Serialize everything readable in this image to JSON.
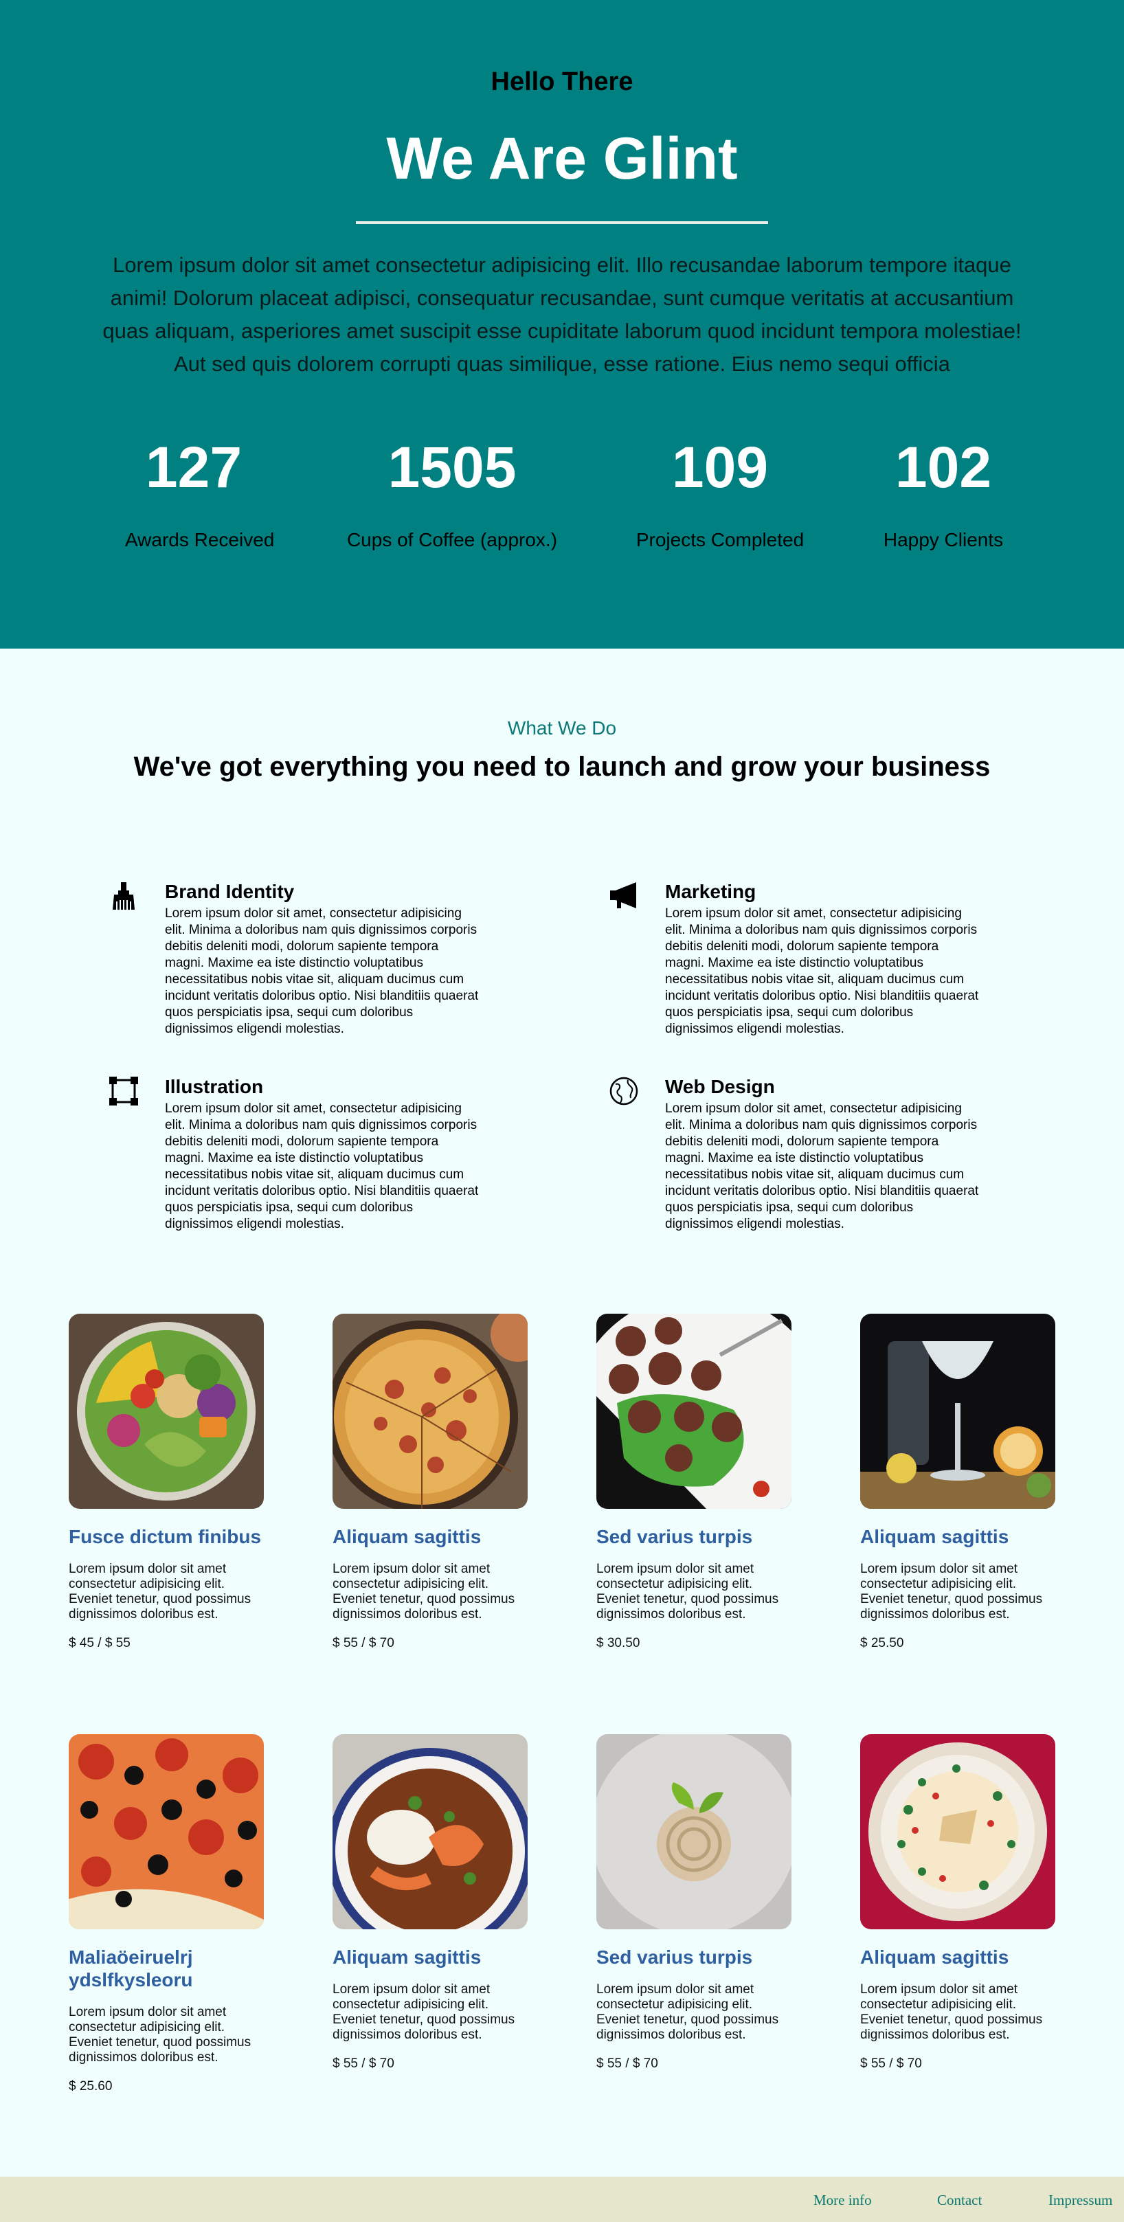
{
  "hero": {
    "greeting": "Hello There",
    "title": "We Are Glint",
    "description": "Lorem ipsum dolor sit amet consectetur adipisicing elit. Illo recusandae laborum tempore itaque animi! Dolorum placeat adipisci, consequatur recusandae, sunt cumque veritatis at accusantium quas aliquam, asperiores amet suscipit esse cupiditate laborum quod incidunt tempora molestiae! Aut sed quis dolorem corrupti quas similique, esse ratione. Eius nemo sequi officia",
    "stats": [
      {
        "number": "127",
        "label": "Awards Received"
      },
      {
        "number": "1505",
        "label": "Cups of Coffee (approx.)"
      },
      {
        "number": "109",
        "label": "Projects Completed"
      },
      {
        "number": "102",
        "label": "Happy Clients"
      }
    ]
  },
  "services_section": {
    "eyebrow": "What We Do",
    "heading": "We've got everything you need to launch and grow your business",
    "items": [
      {
        "title": "Brand Identity",
        "icon": "brush-icon",
        "text": "Lorem ipsum dolor sit amet, consectetur adipisicing elit. Minima a doloribus nam quis dignissimos corporis debitis deleniti modi, dolorum sapiente tempora magni. Maxime ea iste distinctio voluptatibus necessitatibus nobis vitae sit, aliquam ducimus cum incidunt veritatis doloribus optio. Nisi blanditiis quaerat quos perspiciatis ipsa, sequi cum doloribus dignissimos eligendi molestias."
      },
      {
        "title": "Marketing",
        "icon": "megaphone-icon",
        "text": "Lorem ipsum dolor sit amet, consectetur adipisicing elit. Minima a doloribus nam quis dignissimos corporis debitis deleniti modi, dolorum sapiente tempora magni. Maxime ea iste distinctio voluptatibus necessitatibus nobis vitae sit, aliquam ducimus cum incidunt veritatis doloribus optio. Nisi blanditiis quaerat quos perspiciatis ipsa, sequi cum doloribus dignissimos eligendi molestias."
      },
      {
        "title": "Illustration",
        "icon": "vector-square-icon",
        "text": "Lorem ipsum dolor sit amet, consectetur adipisicing elit. Minima a doloribus nam quis dignissimos corporis debitis deleniti modi, dolorum sapiente tempora magni. Maxime ea iste distinctio voluptatibus necessitatibus nobis vitae sit, aliquam ducimus cum incidunt veritatis doloribus optio. Nisi blanditiis quaerat quos perspiciatis ipsa, sequi cum doloribus dignissimos eligendi molestias."
      },
      {
        "title": "Web Design",
        "icon": "globe-icon",
        "text": "Lorem ipsum dolor sit amet, consectetur adipisicing elit. Minima a doloribus nam quis dignissimos corporis debitis deleniti modi, dolorum sapiente tempora magni. Maxime ea iste distinctio voluptatibus necessitatibus nobis vitae sit, aliquam ducimus cum incidunt veritatis doloribus optio. Nisi blanditiis quaerat quos perspiciatis ipsa, sequi cum doloribus dignissimos eligendi molestias."
      }
    ]
  },
  "menu_items": [
    {
      "title": "Fusce dictum finibus",
      "desc": "Lorem ipsum dolor sit amet consectetur adipisicing elit. Eveniet tenetur, quod possimus dignissimos doloribus est.",
      "price": "$ 45 / $ 55",
      "image": "salad-bowl-photo"
    },
    {
      "title": "Aliquam sagittis",
      "desc": "Lorem ipsum dolor sit amet consectetur adipisicing elit. Eveniet tenetur, quod possimus dignissimos doloribus est.",
      "price": "$ 55 / $ 70",
      "image": "pizza-photo"
    },
    {
      "title": "Sed varius turpis",
      "desc": "Lorem ipsum dolor sit amet consectetur adipisicing elit. Eveniet tenetur, quod possimus dignissimos doloribus est.",
      "price": "$ 30.50",
      "image": "meatballs-photo"
    },
    {
      "title": "Aliquam sagittis",
      "desc": "Lorem ipsum dolor sit amet consectetur adipisicing elit. Eveniet tenetur, quod possimus dignissimos doloribus est.",
      "price": "$ 25.50",
      "image": "gin-tonic-photo"
    },
    {
      "title": "Maliaöeiruelrj ydslfkysleoru",
      "desc": "Lorem ipsum dolor sit amet consectetur adipisicing elit. Eveniet tenetur, quod possimus dignissimos doloribus est.",
      "price": "$ 25.60",
      "image": "pepperoni-olive-pizza-photo"
    },
    {
      "title": "Aliquam sagittis",
      "desc": "Lorem ipsum dolor sit amet consectetur adipisicing elit. Eveniet tenetur, quod possimus dignissimos doloribus est.",
      "price": "$ 55 / $ 70",
      "image": "shrimp-curry-photo"
    },
    {
      "title": "Sed varius turpis",
      "desc": "Lorem ipsum dolor sit amet consectetur adipisicing elit. Eveniet tenetur, quod possimus dignissimos doloribus est.",
      "price": "$ 55 / $ 70",
      "image": "pasta-swirl-photo"
    },
    {
      "title": "Aliquam sagittis",
      "desc": "Lorem ipsum dolor sit amet consectetur adipisicing elit. Eveniet tenetur, quod possimus dignissimos doloribus est.",
      "price": "$ 55 / $ 70",
      "image": "pasta-plate-photo"
    }
  ],
  "footer": {
    "links": [
      "More info",
      "Contact",
      "Impressum"
    ]
  },
  "colors": {
    "hero_bg": "#008080",
    "page_bg": "#f0fffe",
    "card_title": "#2f5f9f",
    "eyebrow": "#0e7878",
    "footer_bg": "#e6e6cc"
  }
}
